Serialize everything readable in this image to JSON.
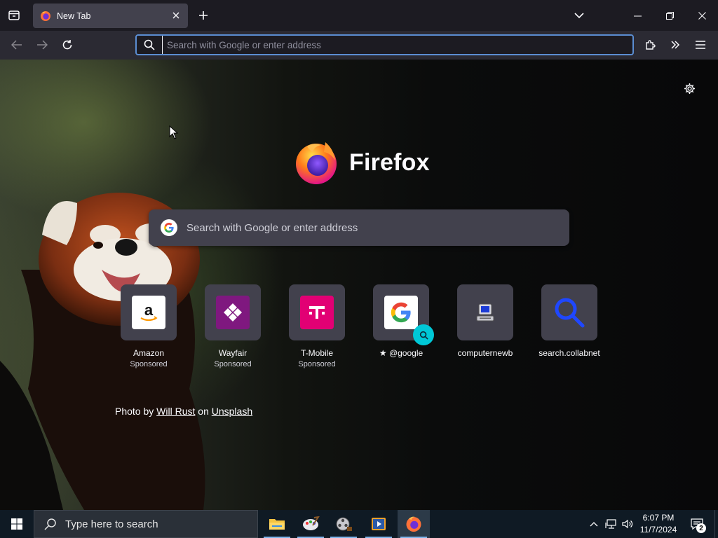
{
  "browser": {
    "tab": {
      "title": "New Tab"
    },
    "urlbar": {
      "placeholder": "Search with Google or enter address"
    }
  },
  "newtab": {
    "brand": "Firefox",
    "search_placeholder": "Search with Google or enter address",
    "shortcuts": [
      {
        "title": "Amazon",
        "subtitle": "Sponsored"
      },
      {
        "title": "Wayfair",
        "subtitle": "Sponsored"
      },
      {
        "title": "T-Mobile",
        "subtitle": "Sponsored"
      },
      {
        "title": "@google",
        "subtitle": ""
      },
      {
        "title": "computernewb",
        "subtitle": ""
      },
      {
        "title": "search.collabnet",
        "subtitle": ""
      }
    ],
    "photo_credit": {
      "prefix": "Photo by",
      "author": "Will Rust",
      "middle": "on",
      "source": "Unsplash"
    }
  },
  "taskbar": {
    "search_placeholder": "Type here to search",
    "clock_time": "6:07 PM",
    "clock_date": "11/7/2024",
    "notification_count": "2"
  },
  "colors": {
    "tab_bar": "#1c1b22",
    "nav_bar": "#2b2a33",
    "focus_ring": "#5b8dd2",
    "tile": "#42414d",
    "search_badge": "#00c8d7",
    "taskbar": "#0f1a24"
  }
}
